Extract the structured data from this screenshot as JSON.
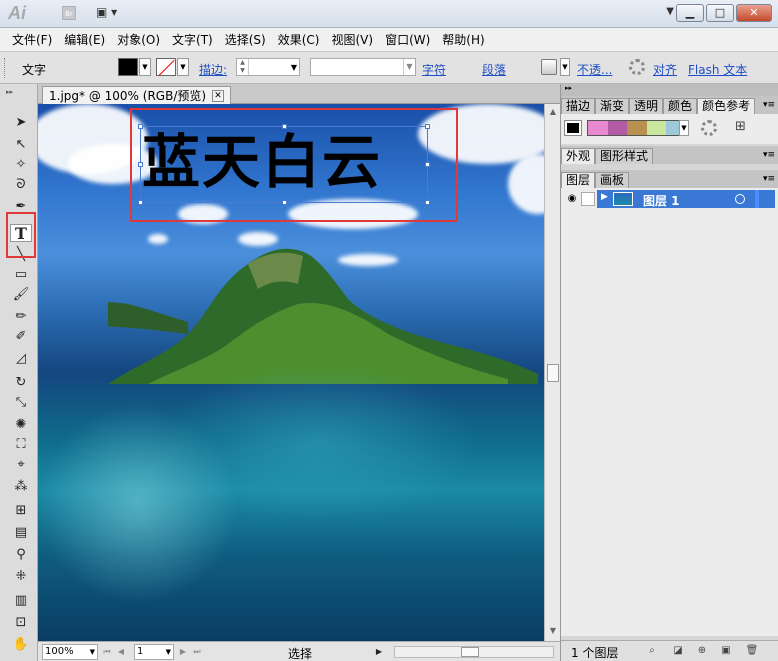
{
  "app": {
    "logo": "Ai",
    "bridge": "Br"
  },
  "window_controls": {
    "minimize": "▁",
    "restore": "□",
    "close": "✕",
    "workspace_arrow": "▼"
  },
  "menu": [
    "文件(F)",
    "编辑(E)",
    "对象(O)",
    "文字(T)",
    "选择(S)",
    "效果(C)",
    "视图(V)",
    "窗口(W)",
    "帮助(H)"
  ],
  "control_bar": {
    "tool_label": "文字",
    "stroke_label": "描边:",
    "char_link": "字符",
    "para_link": "段落",
    "opacity_link": "不透...",
    "align_link": "对齐",
    "flash_link": "Flash 文本",
    "fill_color": "#000000"
  },
  "document": {
    "tab_title": "1.jpg* @ 100% (RGB/预览)",
    "tab_close": "✕"
  },
  "canvas": {
    "text": "蓝天白云"
  },
  "status": {
    "zoom": "100%",
    "page": "1",
    "tool": "选择"
  },
  "panels": {
    "top_tabs": [
      "描边",
      "渐变",
      "透明",
      "颜色",
      "颜色参考"
    ],
    "mid_tabs": [
      "外观",
      "图形样式"
    ],
    "layer_tabs": [
      "图层",
      "画板"
    ],
    "color_guide_strip": [
      "#e88ad0",
      "#b25aa3",
      "#b89050",
      "#c9e89f",
      "#9ec8d8"
    ],
    "menu_icon": "▾≡"
  },
  "layers": {
    "items": [
      {
        "name": "图层 1"
      }
    ],
    "footer_count": "1 个图层"
  }
}
